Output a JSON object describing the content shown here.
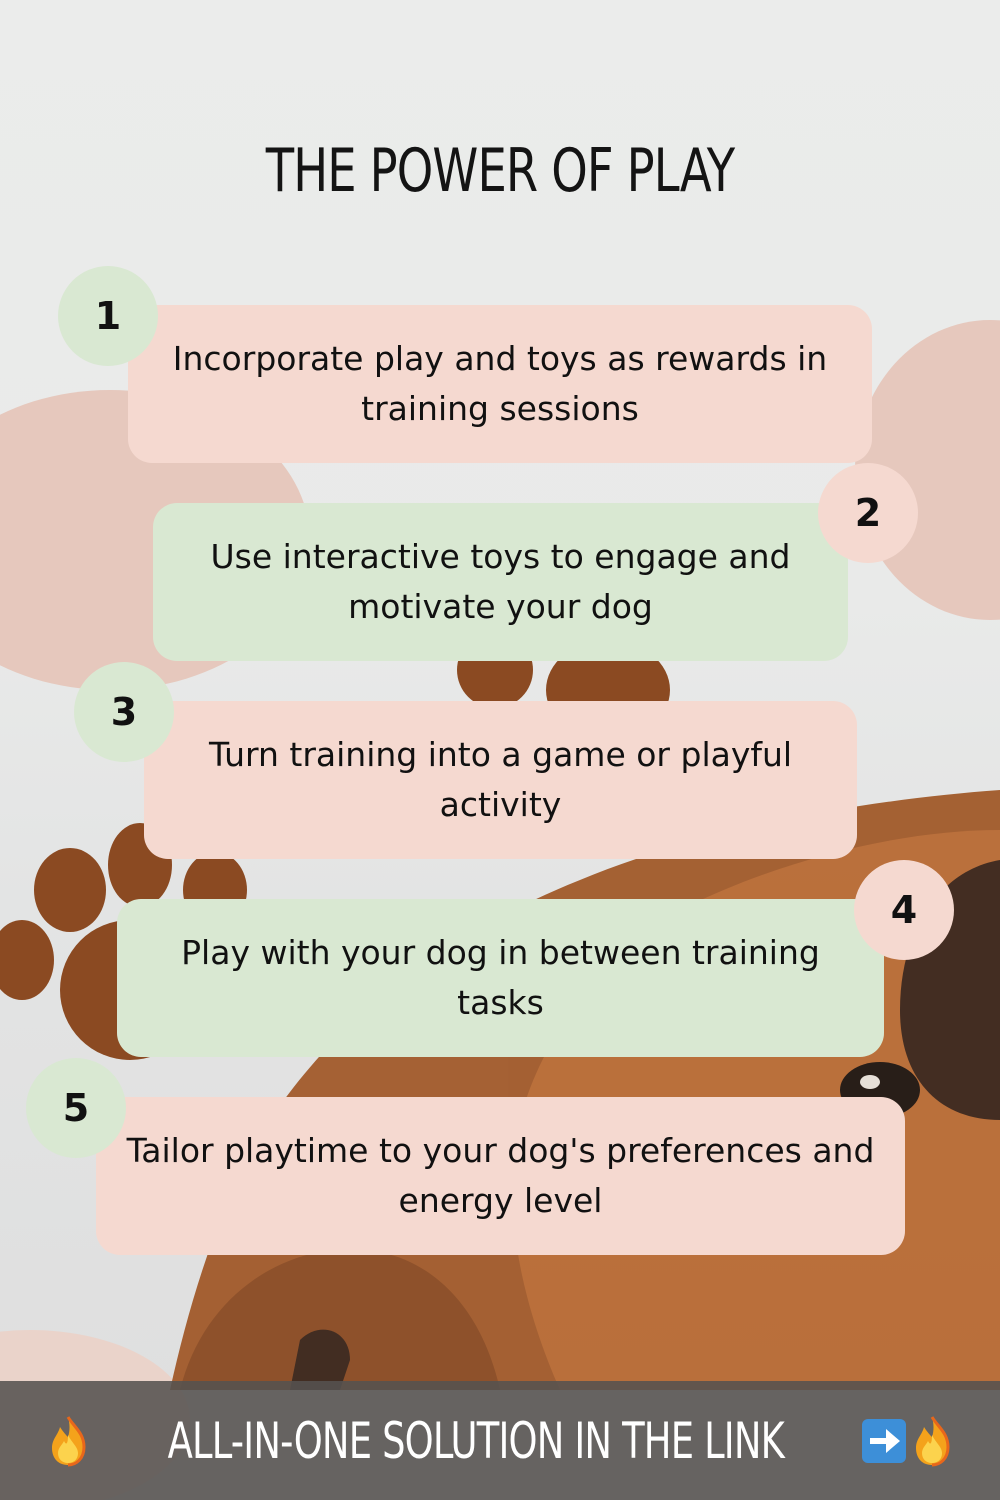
{
  "title": "THE POWER OF PLAY",
  "tips": [
    {
      "number": "1",
      "text": "Incorporate play and toys as rewards in training sessions"
    },
    {
      "number": "2",
      "text": "Use interactive toys to engage and motivate your dog"
    },
    {
      "number": "3",
      "text": "Turn training into a game or playful activity"
    },
    {
      "number": "4",
      "text": "Play with your dog in between training tasks"
    },
    {
      "number": "5",
      "text": "Tailor playtime to your dog's preferences and energy level"
    }
  ],
  "footer": {
    "text": "ALL-IN-ONE SOLUTION IN THE LINK",
    "icons": [
      "fire-icon",
      "arrow-right-icon",
      "fire-icon"
    ]
  },
  "colors": {
    "pink_card": "#f5d9d0",
    "green_card": "#d9e8d2",
    "paw_brown": "#8b4a22",
    "blob_pink": "#e6c8bd",
    "footer_bg": "#555250"
  }
}
